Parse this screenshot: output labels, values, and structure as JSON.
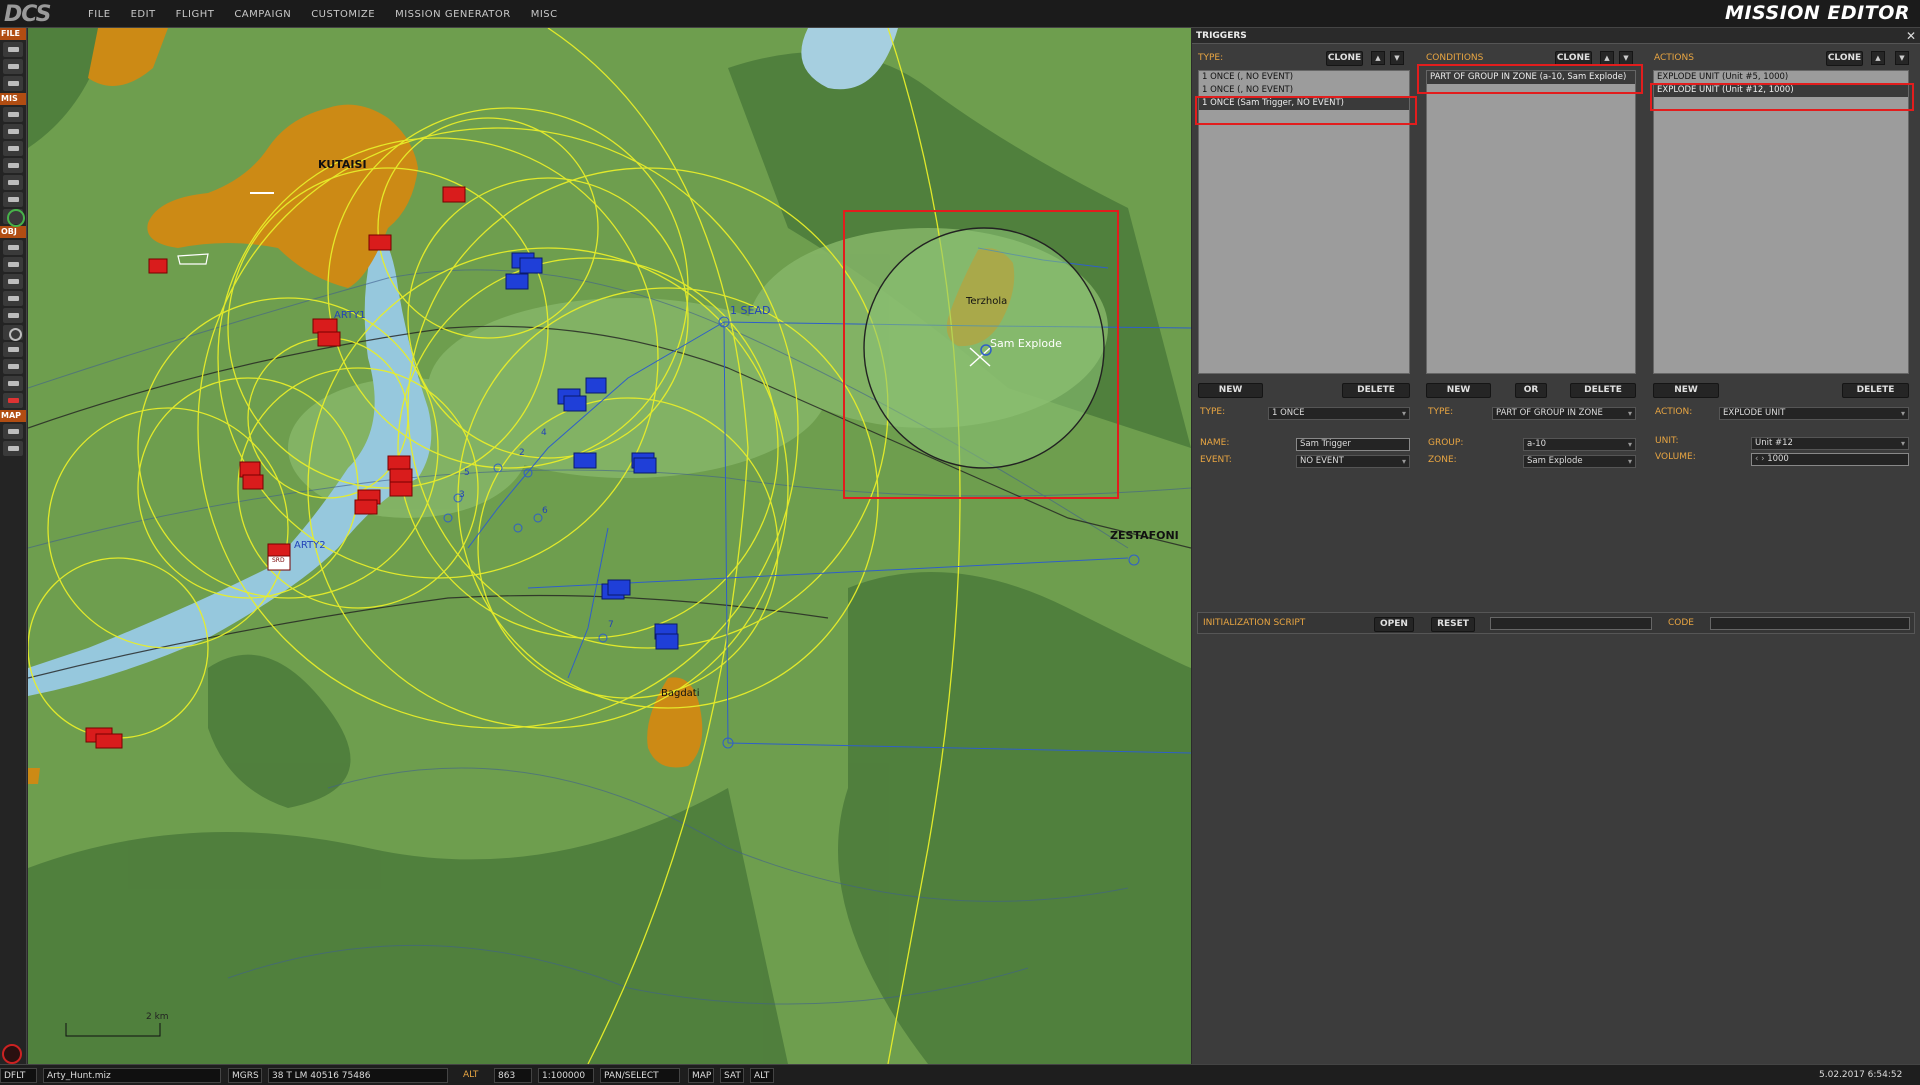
{
  "app": {
    "logo": "DCS",
    "title": "MISSION EDITOR"
  },
  "menu": [
    "FILE",
    "EDIT",
    "FLIGHT",
    "CAMPAIGN",
    "CUSTOMIZE",
    "MISSION GENERATOR",
    "MISC"
  ],
  "leftbar": {
    "file": "FILE",
    "mis": "MIS",
    "obj": "OBJ",
    "map": "MAP"
  },
  "map": {
    "cities": [
      "KUTAISI",
      "Terzhola",
      "Bagdati",
      "ZESTAFONI"
    ],
    "zones": [
      "Sam Explode"
    ],
    "labels": [
      "ARTY1",
      "ARTY2",
      "1 SEAD",
      "2",
      "3",
      "4",
      "5",
      "6",
      "7"
    ],
    "scale": "2 km",
    "unit_badge": "SRD"
  },
  "triggers": {
    "header": "TRIGGERS",
    "type_col": {
      "title": "TYPE:",
      "clone": "CLONE",
      "items": [
        "1 ONCE (, NO EVENT)",
        "1 ONCE (, NO EVENT)",
        "1 ONCE (Sam Trigger, NO EVENT)"
      ],
      "new": "NEW",
      "delete": "DELETE",
      "type_label": "TYPE:",
      "type_value": "1 ONCE",
      "name_label": "NAME:",
      "name_value": "Sam Trigger",
      "event_label": "EVENT:",
      "event_value": "NO EVENT"
    },
    "cond_col": {
      "title": "CONDITIONS",
      "clone": "CLONE",
      "items": [
        "PART OF GROUP IN ZONE (a-10, Sam Explode)"
      ],
      "new": "NEW",
      "or": "OR",
      "delete": "DELETE",
      "type_label": "TYPE:",
      "type_value": "PART OF GROUP IN ZONE",
      "group_label": "GROUP:",
      "group_value": "a-10",
      "zone_label": "ZONE:",
      "zone_value": "Sam Explode"
    },
    "act_col": {
      "title": "ACTIONS",
      "clone": "CLONE",
      "items": [
        "EXPLODE UNIT (Unit #5, 1000)",
        "EXPLODE UNIT (Unit #12, 1000)"
      ],
      "new": "NEW",
      "delete": "DELETE",
      "action_label": "ACTION:",
      "action_value": "EXPLODE UNIT",
      "unit_label": "UNIT:",
      "unit_value": "Unit #12",
      "volume_label": "VOLUME:",
      "volume_value": "1000"
    },
    "init": {
      "label": "INITIALIZATION SCRIPT",
      "open": "OPEN",
      "reset": "RESET",
      "code": "CODE"
    }
  },
  "status": {
    "mode": "DFLT",
    "file": "Arty_Hunt.miz",
    "coord_type": "MGRS",
    "coord": "38 T LM 40516 75486",
    "alt_label": "ALT",
    "alt_value": "863",
    "scale": "1:100000",
    "tool": "PAN/SELECT",
    "map": "MAP",
    "sat": "SAT",
    "alt_btn": "ALT",
    "datetime": "5.02.2017 6:54:52"
  }
}
